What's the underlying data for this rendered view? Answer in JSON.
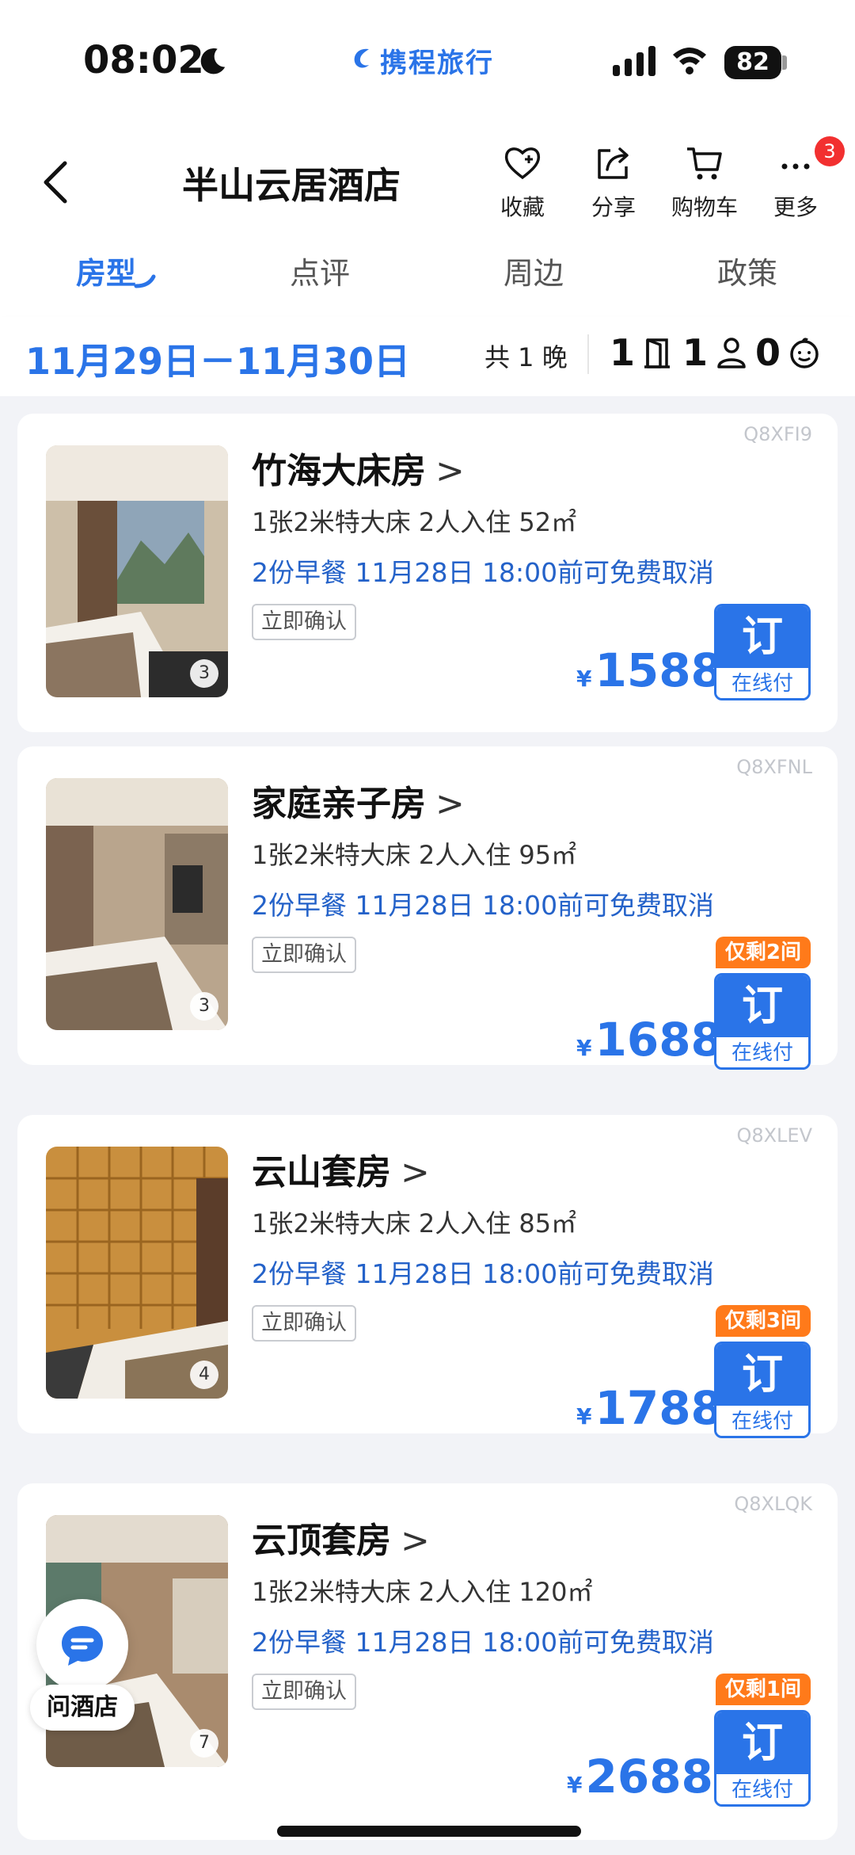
{
  "status": {
    "time": "08:02",
    "brand": "携程旅行",
    "battery": "82"
  },
  "header": {
    "title": "半山云居酒店",
    "actions": [
      {
        "label": "收藏"
      },
      {
        "label": "分享"
      },
      {
        "label": "购物车"
      },
      {
        "label": "更多",
        "badge": "3"
      }
    ]
  },
  "tabs": [
    "房型",
    "点评",
    "周边",
    "政策"
  ],
  "active_tab": "房型",
  "date_bar": {
    "range": "11月29日－11月30日",
    "nights": "共 1 晚",
    "rooms": "1",
    "adults": "1",
    "children": "0"
  },
  "rooms": [
    {
      "code": "Q8XFI9",
      "name": "竹海大床房",
      "spec": "1张2米特大床   2人入住   52㎡",
      "policy": "2份早餐   11月28日 18:00前可免费取消",
      "confirm": "立即确认",
      "remain": "",
      "currency": "¥",
      "price": "1588",
      "photos": "3",
      "book": "订",
      "pay": "在线付"
    },
    {
      "code": "Q8XFNL",
      "name": "家庭亲子房",
      "spec": "1张2米特大床   2人入住   95㎡",
      "policy": "2份早餐   11月28日 18:00前可免费取消",
      "confirm": "立即确认",
      "remain": "仅剩2间",
      "currency": "¥",
      "price": "1688",
      "photos": "3",
      "book": "订",
      "pay": "在线付"
    },
    {
      "code": "Q8XLEV",
      "name": "云山套房",
      "spec": "1张2米特大床   2人入住   85㎡",
      "policy": "2份早餐   11月28日 18:00前可免费取消",
      "confirm": "立即确认",
      "remain": "仅剩3间",
      "currency": "¥",
      "price": "1788",
      "photos": "4",
      "book": "订",
      "pay": "在线付"
    },
    {
      "code": "Q8XLQK",
      "name": "云顶套房",
      "spec": "1张2米特大床   2人入住   120㎡",
      "policy": "2份早餐   11月28日 18:00前可免费取消",
      "confirm": "立即确认",
      "remain": "仅剩1间",
      "currency": "¥",
      "price": "2688",
      "photos": "7",
      "book": "订",
      "pay": "在线付"
    }
  ],
  "ask_hotel": "问酒店",
  "colors": {
    "accent": "#2a74e8",
    "remain": "#ff7a1a",
    "badge": "#f23030"
  }
}
